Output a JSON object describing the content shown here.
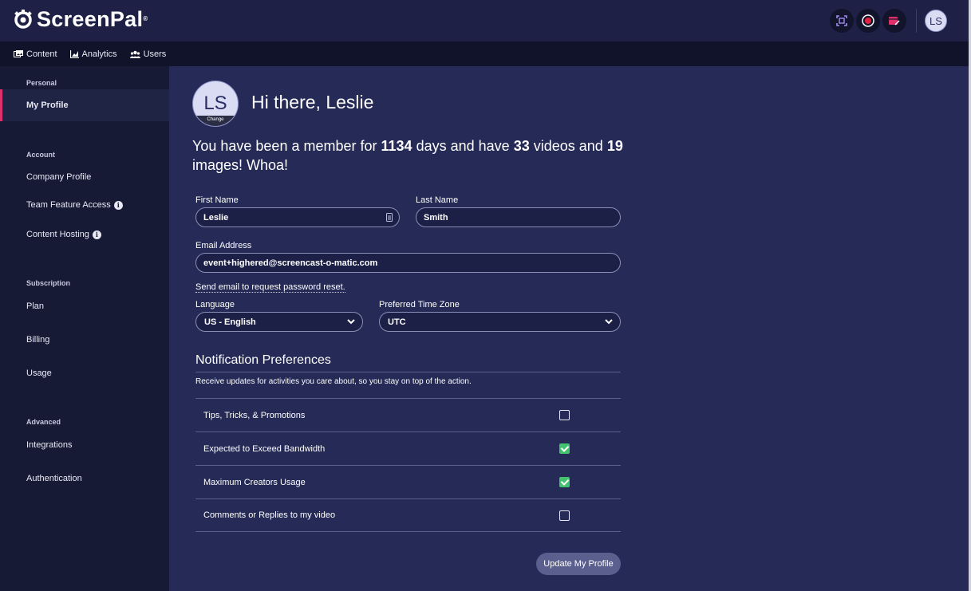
{
  "app": {
    "name": "ScreenPal",
    "registered": "®"
  },
  "header": {
    "avatar_initials": "LS",
    "icons": [
      "screen-capture-icon",
      "record-icon",
      "video-editor-icon"
    ]
  },
  "nav": {
    "items": [
      {
        "label": "Content",
        "icon": "content-icon"
      },
      {
        "label": "Analytics",
        "icon": "analytics-icon"
      },
      {
        "label": "Users",
        "icon": "users-icon"
      }
    ]
  },
  "sidebar": {
    "personal_label": "Personal",
    "my_profile": "My Profile",
    "account_label": "Account",
    "company_profile": "Company Profile",
    "team_feature_access": "Team Feature Access",
    "content_hosting": "Content Hosting",
    "subscription_label": "Subscription",
    "plan": "Plan",
    "billing": "Billing",
    "usage": "Usage",
    "advanced_label": "Advanced",
    "integrations": "Integrations",
    "authentication": "Authentication",
    "info_glyph": "i"
  },
  "profile": {
    "avatar_initials": "LS",
    "change_label": "Change",
    "greeting": "Hi there, Leslie",
    "member_prefix": "You have been a member for",
    "days": "1134",
    "days_text": "days and have",
    "videos": "33",
    "videos_text": "videos and",
    "images": "19",
    "images_text": "images! Whoa!"
  },
  "form": {
    "first_name_label": "First Name",
    "first_name_value": "Leslie",
    "last_name_label": "Last Name",
    "last_name_value": "Smith",
    "email_label": "Email Address",
    "email_value": "event+highered@screencast-o-matic.com",
    "reset_link": "Send email to request password reset.",
    "language_label": "Language",
    "language_value": "US - English",
    "timezone_label": "Preferred Time Zone",
    "timezone_value": "UTC"
  },
  "notifications": {
    "title": "Notification Preferences",
    "description": "Receive updates for activities you care about, so you stay on top of the action.",
    "rows": [
      {
        "label": "Tips, Tricks, & Promotions",
        "checked": false
      },
      {
        "label": "Expected to Exceed Bandwidth",
        "checked": true
      },
      {
        "label": "Maximum Creators Usage",
        "checked": true
      },
      {
        "label": "Comments or Replies to my video",
        "checked": false
      }
    ]
  },
  "update_button": "Update My Profile"
}
